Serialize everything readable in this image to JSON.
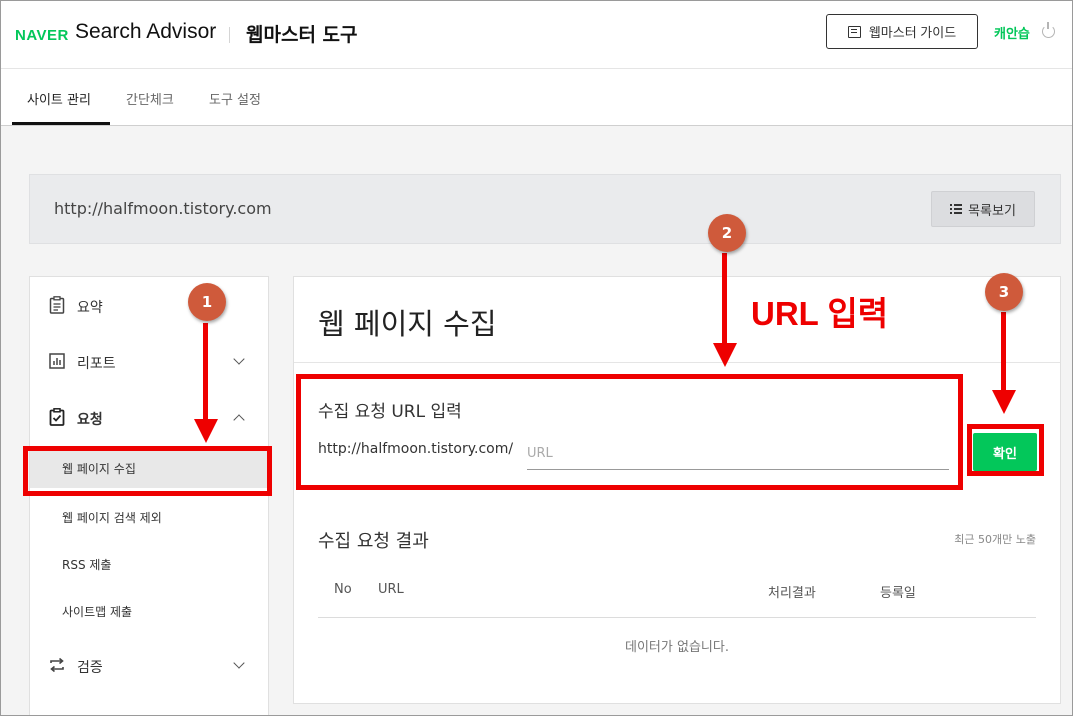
{
  "header": {
    "brand": "NAVER",
    "product": "Search Advisor",
    "section": "웹마스터 도구",
    "guide_button": "웹마스터 가이드",
    "user_name": "캐안습",
    "brand_color": "#03c75a"
  },
  "tabs": [
    {
      "label": "사이트 관리",
      "active": true
    },
    {
      "label": "간단체크",
      "active": false
    },
    {
      "label": "도구 설정",
      "active": false
    }
  ],
  "site": {
    "url": "http://halfmoon.tistory.com",
    "list_button": "목록보기"
  },
  "sidebar": {
    "items": [
      {
        "label": "요약",
        "icon": "clipboard-icon"
      },
      {
        "label": "리포트",
        "icon": "chart-icon"
      },
      {
        "label": "요청",
        "icon": "clipboard-check-icon"
      },
      {
        "label": "검증",
        "icon": "repeat-icon"
      }
    ],
    "sub_items": [
      {
        "label": "웹 페이지 수집",
        "active": true
      },
      {
        "label": "웹 페이지 검색 제외",
        "active": false
      },
      {
        "label": "RSS 제출",
        "active": false
      },
      {
        "label": "사이트맵 제출",
        "active": false
      }
    ]
  },
  "main": {
    "title": "웹 페이지 수집",
    "form_title": "수집 요청 URL 입력",
    "url_prefix": "http://halfmoon.tistory.com/",
    "url_placeholder": "URL",
    "url_value": "",
    "confirm_button": "확인",
    "result_title": "수집 요청 결과",
    "result_note": "최근 50개만 노출",
    "columns": [
      "No",
      "URL",
      "처리결과",
      "등록일"
    ],
    "empty_message": "데이터가 없습니다."
  },
  "annotations": {
    "badges": [
      "1",
      "2",
      "3"
    ],
    "label": "URL 입력",
    "color": "#ee0000"
  }
}
